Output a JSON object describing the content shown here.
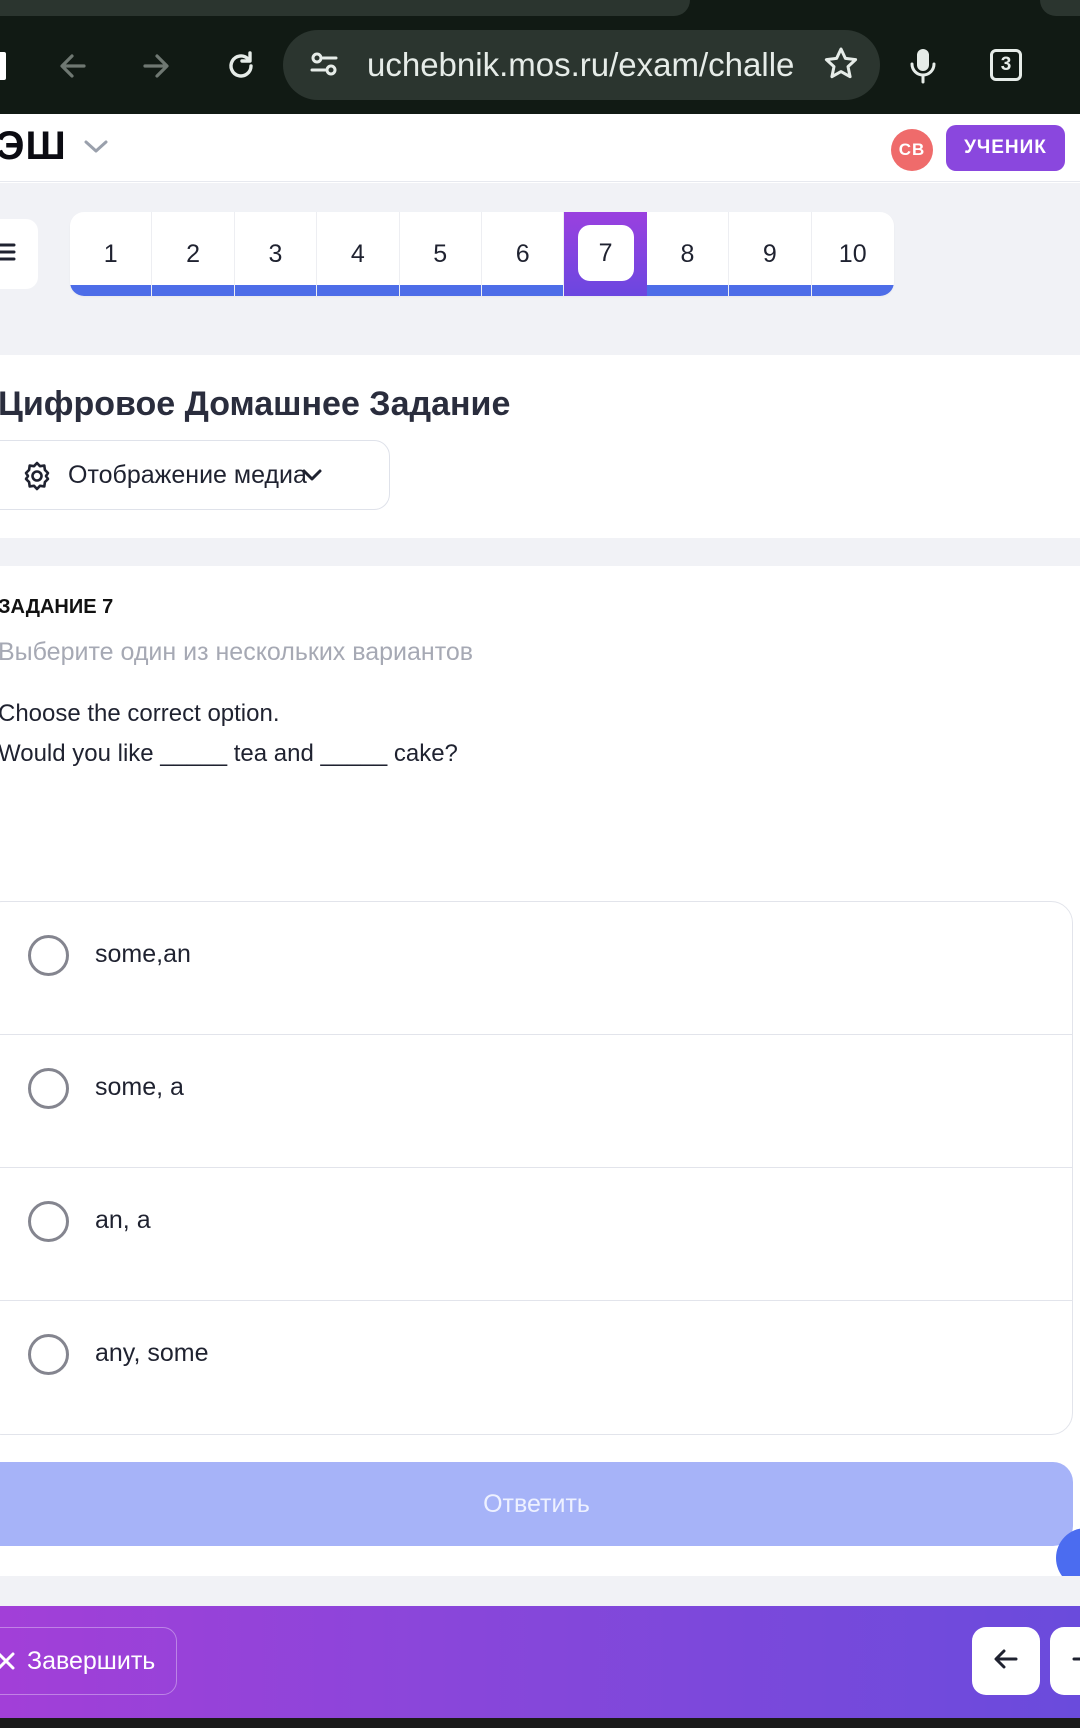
{
  "browser": {
    "url": "uchebnik.mos.ru/exam/challe",
    "tab_count": "3"
  },
  "header": {
    "logo": "ЭШ",
    "avatar_initials": "СВ",
    "role": "УЧЕНИК"
  },
  "question_nav": {
    "items": [
      "1",
      "2",
      "3",
      "4",
      "5",
      "6",
      "7",
      "8",
      "9",
      "10"
    ],
    "active": "7"
  },
  "page": {
    "title": "Цифровое Домашнее Задание",
    "media_dropdown": "Отображение медиа"
  },
  "task": {
    "label": "ЗАДАНИЕ 7",
    "hint": "Выберите один из нескольких вариантов",
    "question_line1": "Choose the correct option.",
    "question_line2": "Would you like _____ tea and _____ cake?",
    "options": [
      "some,an",
      "some, a",
      "an, a",
      "any, some"
    ],
    "submit_label": "Ответить"
  },
  "footer": {
    "finish_label": "Завершить"
  },
  "colors": {
    "accent_purple": "#8a47de",
    "nav_progress": "#4d6de8",
    "submit_disabled": "#a6b3f8",
    "avatar": "#ef6b6b"
  },
  "icons": [
    "back-arrow-icon",
    "forward-arrow-icon",
    "reload-icon",
    "site-settings-icon",
    "star-icon",
    "microphone-icon",
    "menu-icon",
    "gear-icon",
    "chevron-down-icon",
    "close-icon",
    "arrow-left-icon",
    "arrow-right-icon"
  ]
}
